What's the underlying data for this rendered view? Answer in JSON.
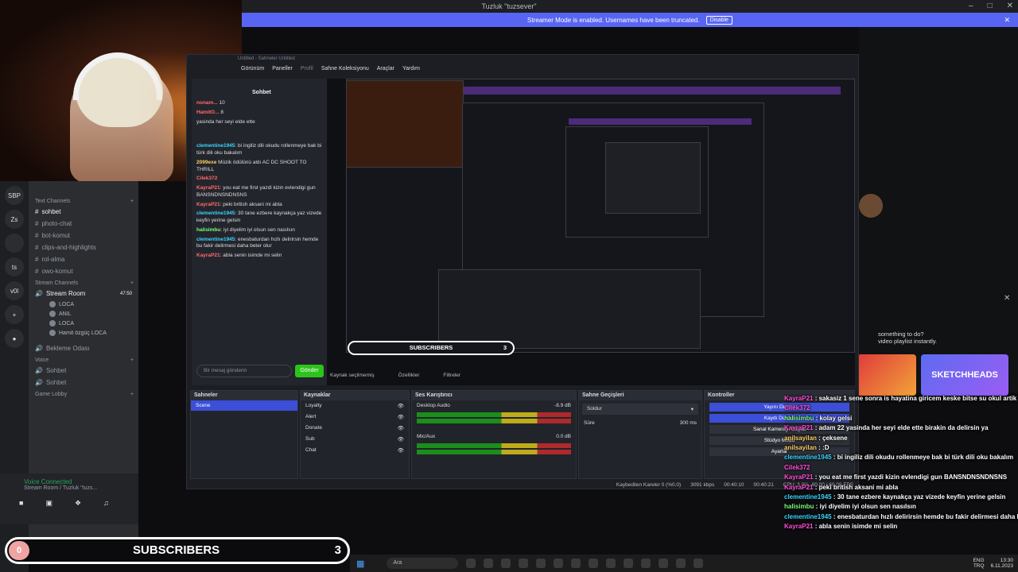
{
  "window": {
    "title": "Tuzluk \"tuzsever\""
  },
  "streamer_bar": {
    "text": "Streamer Mode is enabled. Usernames have been truncated.",
    "disable_label": "Disable"
  },
  "guilds": [
    "SBP",
    "Zs",
    "ts",
    "v0l"
  ],
  "channels": {
    "text_category": "Text Channels",
    "text": [
      "sohbet",
      "photo-chat",
      "bot-komut",
      "clips-and-highlights",
      "rol-alma",
      "owo-komut"
    ],
    "stream_category": "Stream Channels",
    "stream_room": "Stream Room",
    "stream_room_time": "47:50",
    "stream_users": [
      "LOCA",
      "ANIL",
      "LOCA",
      "Hamit özgüç LOCA"
    ],
    "bekleme": "Bekleme Odası",
    "voice_category": "Voice",
    "voice": [
      "Sohbet",
      "Sohbet"
    ],
    "game_category": "Game Lobby"
  },
  "voice_panel": {
    "status": "Voice Connected",
    "sub": "Stream Room / Tuzluk \"tuzs..."
  },
  "obs": {
    "title": "Untitled - Sahneler Untitled",
    "menu": [
      "Görünüm",
      "Paneller",
      "Profil",
      "Sahne Koleksiyonu",
      "Araçlar",
      "Yardım"
    ],
    "chat_title": "Sohbet",
    "chat_input_placeholder": "Bir mesaj gönderin",
    "send_label": "Gönder",
    "source_missing": "Kaynak seçilmemiş",
    "tab_properties": "Özellikler",
    "tab_filters": "Filtreler",
    "scenes_title": "Sahneler",
    "scene": "Scene",
    "sources_title": "Kaynaklar",
    "sources": [
      "Loyalty",
      "Alert",
      "Donate",
      "Sub",
      "Chat"
    ],
    "mixer_title": "Ses Karıştırıcı",
    "mixer": [
      {
        "name": "Desktop Audio",
        "db": "-8.9 dB"
      },
      {
        "name": "Mic/Aux",
        "db": "0.0 dB"
      }
    ],
    "transitions_title": "Sahne Geçişleri",
    "transition": "Soldur",
    "duration_label": "Süre",
    "duration": "300 ms",
    "controls_title": "Kontroller",
    "controls": [
      "Yayını Durdur",
      "Kaydı Durdur",
      "Sanal Kamerayı Başlat",
      "Stüdyo Modu",
      "Ayarlar"
    ],
    "status_dropped": "Kaybedilen Kareler 0 (%0.0)",
    "status_kbps": "3091 kbps",
    "status_live": "00:40:10",
    "status_rec": "00:40:21",
    "status_cpu": "CPU: 3.0%, 60.00 / 60.00 FPS"
  },
  "small_chat": [
    {
      "user": "nonam...",
      "text": "10"
    },
    {
      "user": "HamitO...",
      "text": "8"
    },
    {
      "user": "",
      "text": "yasinda her seyi elde ette"
    },
    {
      "user": "clementine1945",
      "text": "bi ingiliz dili okudu rollenmeye bak bi türk dili oku bakalım"
    },
    {
      "user": "2099exe",
      "text": "Müzik ödülünü aldı AC DC SHOOT TO THRILL"
    },
    {
      "user": "Cilek372",
      "text": ""
    },
    {
      "user": "KayraP21",
      "text": "you eat me first yazdi kizin evlendigi gun BANSNDNSNDNSNS"
    },
    {
      "user": "KayraP21",
      "text": "peki british aksani mi abla"
    },
    {
      "user": "clementine1945",
      "text": "30 tane ezbere kaynakça yaz vizede keyfin yerine gelsin"
    },
    {
      "user": "halisimbu",
      "text": "iyi diyelim iyi olsun sen nasılsın"
    },
    {
      "user": "clementine1945",
      "text": "enesbaturdan hızlı delirirsin hemde bu fakir delirmesi daha beter olur"
    },
    {
      "user": "KayraP21",
      "text": "abla senin isimde mi selin"
    }
  ],
  "subs_small": {
    "label": "SUBSCRIBERS",
    "count": "3"
  },
  "overlay_chat": [
    {
      "user": "KayraP21",
      "text": "sakasiz 1 sene sonra is hayatina giricem keske bitse su okul artik"
    },
    {
      "user": "Cilek372",
      "text": ""
    },
    {
      "user": "halisimbu",
      "text": "kolay gelsi"
    },
    {
      "user": "KayraP21",
      "text": "adam 22 yasinda her seyi elde ette birakin da delirsin ya"
    },
    {
      "user": "anilsayilan",
      "text": "çeksene"
    },
    {
      "user": "anilsayilan",
      "text": ":D"
    },
    {
      "user": "clementine1945",
      "text": "bi ingiliz dili okudu rollenmeye bak bi türk dili oku bakalım"
    },
    {
      "user": "Cilek372",
      "text": ""
    },
    {
      "user": "KayraP21",
      "text": "you eat me first yazdi kizin evlendigi gun BANSNDNSNDNSNS"
    },
    {
      "user": "KayraP21",
      "text": "peki british aksani mi abla"
    },
    {
      "user": "clementine1945",
      "text": "30 tane ezbere kaynakça yaz vizede keyfin yerine gelsin"
    },
    {
      "user": "halisimbu",
      "text": "iyi diyelim iyi olsun sen nasılsın"
    },
    {
      "user": "clementine1945",
      "text": "enesbaturdan hızlı delirirsin hemde bu fakir delirmesi daha beter olur"
    },
    {
      "user": "KayraP21",
      "text": "abla senin isimde mi selin"
    }
  ],
  "right_panel": {
    "text1": "something to do?",
    "text2": "video playlist instantly.",
    "game2": "SKETCHHEADS"
  },
  "subs": {
    "badge": "0",
    "label": "SUBSCRIBERS",
    "count": "3"
  },
  "taskbar": {
    "search": "Ara",
    "lang1": "ENG",
    "lang2": "TRQ",
    "time": "13:30",
    "date": "6.11.2023"
  },
  "colors": {
    "accent": "#5865f2",
    "obs_select": "#3c4fd8",
    "send": "#2cc31a",
    "voice_ok": "#23a55a"
  }
}
